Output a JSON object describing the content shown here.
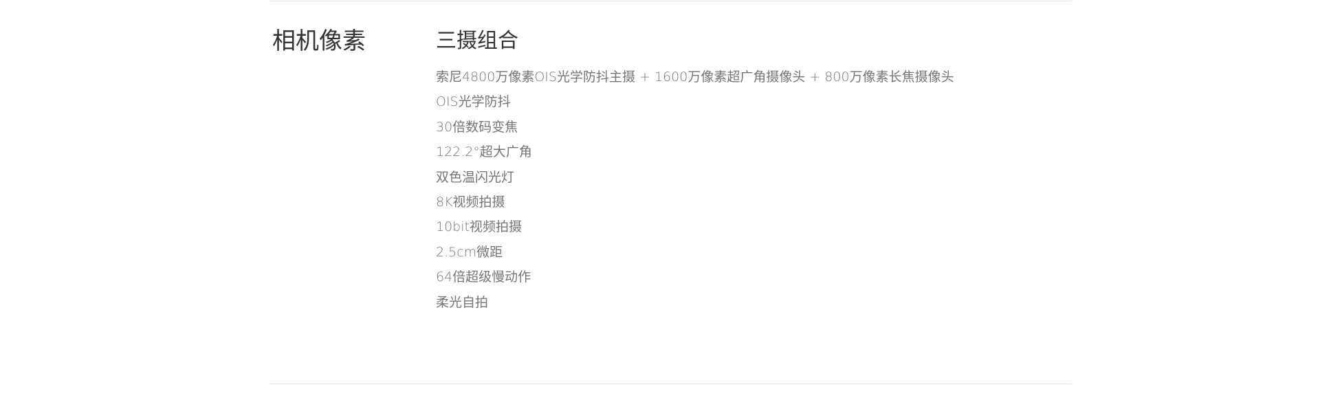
{
  "section": {
    "title": "相机像素",
    "heading": "三摄组合",
    "features": [
      "索尼4800万像素OIS光学防抖主摄 + 1600万像素超广角摄像头 + 800万像素长焦摄像头",
      "OIS光学防抖",
      "30倍数码变焦",
      "122.2°超大广角",
      "双色温闪光灯",
      "8K视频拍摄",
      "10bit视频拍摄",
      "2.5cm微距",
      "64倍超级慢动作",
      "柔光自拍"
    ]
  },
  "colors": {
    "title_text": "#333333",
    "feature_text": "#757575",
    "divider": "#e0e0e0"
  }
}
